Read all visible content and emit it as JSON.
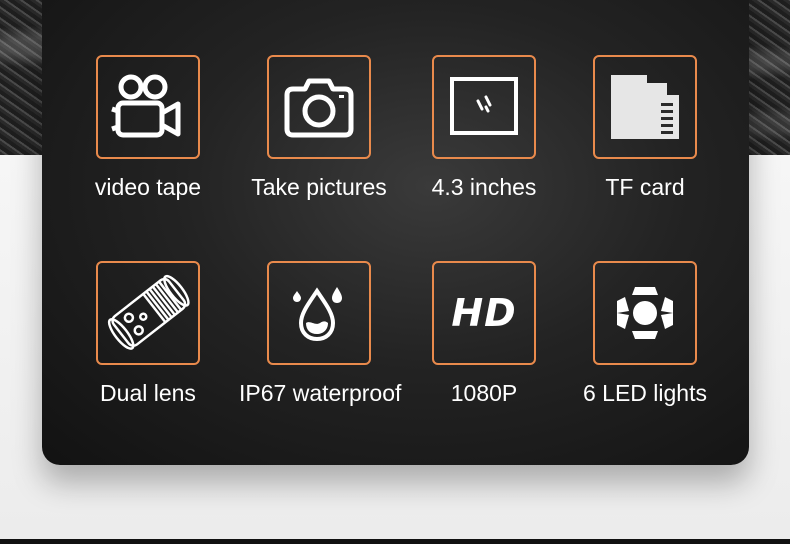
{
  "accent_color": "#e98a4c",
  "features": [
    {
      "label": "video tape",
      "icon": "video-camera-icon"
    },
    {
      "label": "Take pictures",
      "icon": "camera-icon"
    },
    {
      "label": "4.3 inches",
      "icon": "screen-icon"
    },
    {
      "label": "TF card",
      "icon": "sd-card-icon"
    },
    {
      "label": "Dual lens",
      "icon": "dual-lens-probe-icon"
    },
    {
      "label": "IP67 waterproof",
      "icon": "water-drop-icon"
    },
    {
      "label": "1080P",
      "icon": "hd-icon",
      "icon_text": "HD"
    },
    {
      "label": "6 LED lights",
      "icon": "led-lights-icon"
    }
  ]
}
